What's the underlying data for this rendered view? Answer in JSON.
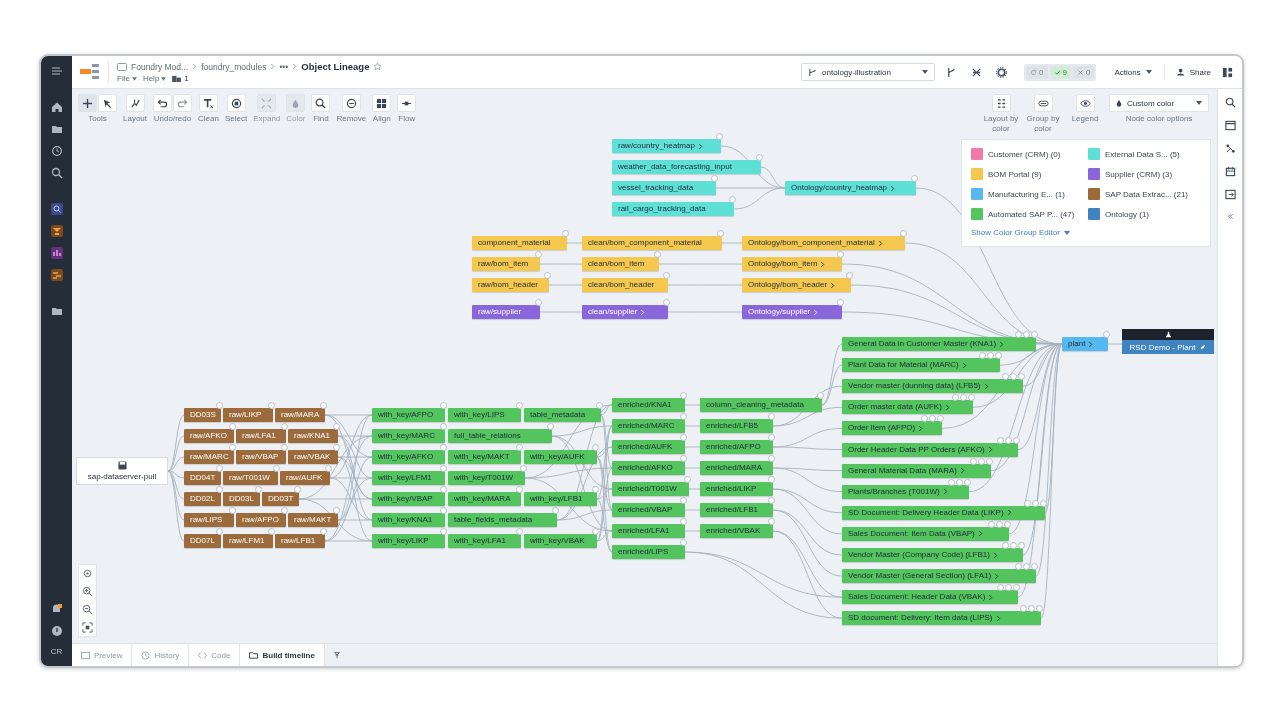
{
  "header": {
    "breadcrumbs": [
      "Foundry Mod...",
      "foundry_modules",
      "•••",
      "Object Lineage"
    ],
    "menus": [
      "File",
      "Help"
    ],
    "count": "1",
    "branch": "ontology-illustration",
    "checks": [
      {
        "kind": "running",
        "count": "0"
      },
      {
        "kind": "passed",
        "count": "9"
      },
      {
        "kind": "failed",
        "count": "0"
      }
    ],
    "actions": "Actions",
    "share": "Share"
  },
  "sidebar": {
    "avatar": "CR"
  },
  "toolbar": [
    {
      "kind": "tools",
      "label": "Tools",
      "disabled": false
    },
    {
      "kind": "layout",
      "label": "Layout",
      "disabled": false
    },
    {
      "kind": "undo",
      "label": "Undo/redo",
      "disabled": false
    },
    {
      "kind": "clean",
      "label": "Clean",
      "disabled": false
    },
    {
      "kind": "select",
      "label": "Select",
      "disabled": false
    },
    {
      "kind": "expand",
      "label": "Expand",
      "disabled": true
    },
    {
      "kind": "color",
      "label": "Color",
      "disabled": true
    },
    {
      "kind": "find",
      "label": "Find",
      "disabled": false
    },
    {
      "kind": "remove",
      "label": "Remove",
      "disabled": false
    },
    {
      "kind": "align",
      "label": "Align",
      "disabled": false
    },
    {
      "kind": "flow",
      "label": "Flow",
      "disabled": false
    }
  ],
  "view_controls": [
    {
      "kind": "layout",
      "label": "Layout by color"
    },
    {
      "kind": "group",
      "label": "Group by color"
    },
    {
      "kind": "legend",
      "label": "Legend"
    }
  ],
  "color_select": {
    "value": "Custom color",
    "caption": "Node color options"
  },
  "legend": {
    "items": [
      {
        "label": "Customer (CRM) (0)",
        "color": "#ee7ba9"
      },
      {
        "label": "External Data S... (5)",
        "color": "#5fe0d6"
      },
      {
        "label": "BOM Portal (9)",
        "color": "#f4c84f"
      },
      {
        "label": "Supplier (CRM) (3)",
        "color": "#8a66db"
      },
      {
        "label": "Manufacturing E... (1)",
        "color": "#57b8ef"
      },
      {
        "label": "SAP Data Extrac... (21)",
        "color": "#9b6b3c"
      },
      {
        "label": "Automated SAP P... (47)",
        "color": "#54c45e"
      },
      {
        "label": "Ontology (1)",
        "color": "#3f84c1"
      }
    ],
    "link": "Show Color Group Editor"
  },
  "graph": {
    "external": {
      "color": "#5fe0d6",
      "sources": [
        {
          "label": "raw/country_heatmap",
          "chevron": true
        },
        {
          "label": "weather_data_forecasting_input",
          "chevron": false
        },
        {
          "label": "vessel_tracking_data",
          "chevron": false
        },
        {
          "label": "rail_cargo_tracking_data",
          "chevron": false
        }
      ],
      "target": {
        "label": "Ontology/country_heatmap",
        "chevron": true
      }
    },
    "bom_rows": [
      {
        "color": "#f4c84f",
        "nodes": [
          {
            "label": "component_material",
            "chevron": false
          },
          {
            "label": "clean/bom_component_material",
            "chevron": false
          },
          {
            "label": "Ontology/bom_component_material",
            "chevron": true
          }
        ]
      },
      {
        "color": "#f4c84f",
        "nodes": [
          {
            "label": "raw/bom_item",
            "chevron": false
          },
          {
            "label": "clean/bom_item",
            "chevron": false
          },
          {
            "label": "Ontology/bom_item",
            "chevron": true
          }
        ]
      },
      {
        "color": "#f4c84f",
        "nodes": [
          {
            "label": "raw/bom_header",
            "chevron": false
          },
          {
            "label": "clean/bom_header",
            "chevron": false
          },
          {
            "label": "Ontology/bom_header",
            "chevron": true
          }
        ]
      },
      {
        "color": "#8a66db",
        "nodes": [
          {
            "label": "raw/supplier",
            "chevron": false
          },
          {
            "label": "clean/supplier",
            "chevron": true
          },
          {
            "label": "Ontology/supplier",
            "chevron": true
          }
        ]
      }
    ],
    "source": {
      "label": "sap-dataserver-pull"
    },
    "raw_rows": {
      "color": "#9b6b3c",
      "rows": [
        [
          "DD03S",
          "raw/LIKP",
          "raw/MARA"
        ],
        [
          "raw/AFKO",
          "raw/LFA1",
          "raw/KNA1"
        ],
        [
          "raw/MARC",
          "raw/VBAP",
          "raw/VBAK"
        ],
        [
          "DD04T",
          "raw/T001W",
          "raw/AUFK"
        ],
        [
          "DD02L",
          "DD03L",
          "DD03T"
        ],
        [
          "raw/LIPS",
          "raw/AFPO",
          "raw/MAKT"
        ],
        [
          "DD07L",
          "raw/LFM1",
          "raw/LFB1"
        ]
      ]
    },
    "key_rows": {
      "color": "#54c45e",
      "rows": [
        [
          "with_key/AFPO",
          "with_key/LIPS",
          "table_metadata"
        ],
        [
          "with_key/MARC",
          "full_table_relations"
        ],
        [
          "with_key/AFKO",
          "with_key/MAKT",
          "with_key/AUFK"
        ],
        [
          "with_key/LFM1",
          "with_key/T001W"
        ],
        [
          "with_key/VBAP",
          "with_key/MARA",
          "with_key/LFB1"
        ],
        [
          "with_key/KNA1",
          "table_fields_metadata"
        ],
        [
          "with_key/LIKP",
          "with_key/LFA1",
          "with_key/VBAK"
        ]
      ]
    },
    "enriched": {
      "color": "#54c45e",
      "columns": [
        [
          "enriched/KNA1",
          "enriched/MARC",
          "enriched/AUFK",
          "enriched/AFKO",
          "enriched/T001W",
          "enriched/VBAP",
          "enriched/LFA1",
          "enriched/LIPS"
        ],
        [
          "column_cleaning_metadata",
          "enriched/LFB5",
          "enriched/AFPO",
          "enriched/MARA",
          "enriched/LIKP",
          "enriched/LFB1",
          "enriched/VBAK"
        ]
      ]
    },
    "outputs": {
      "color": "#54c45e",
      "nodes": [
        {
          "label": "General Data in Customer Master (KNA1)",
          "chevron": true
        },
        {
          "label": "Plant Data for Material (MARC)",
          "chevron": true
        },
        {
          "label": "Vendor master (dunning data) (LFB5)",
          "chevron": true
        },
        {
          "label": "Order master data (AUFK)",
          "chevron": true
        },
        {
          "label": "Order item (AFPO)",
          "chevron": true
        },
        {
          "label": "Order Header Data PP Orders (AFKO)",
          "chevron": true
        },
        {
          "label": "General Material Data (MARA)",
          "chevron": true
        },
        {
          "label": "Plants/Branches (T001W)",
          "chevron": true
        },
        {
          "label": "SD Document: Delivery Header Data (LIKP)",
          "chevron": true
        },
        {
          "label": "Sales Document: Item Data (VBAP)",
          "chevron": true
        },
        {
          "label": "Vendor Master (Company Code) (LFB1)",
          "chevron": true
        },
        {
          "label": "Vendor Master (General Section) (LFA1)",
          "chevron": true
        },
        {
          "label": "Sales Document: Header Data (VBAK)",
          "chevron": true
        },
        {
          "label": "SD document: Delivery: Item data (LIPS)",
          "chevron": true
        }
      ]
    },
    "hub": {
      "label": "plant",
      "color": "#57b8ef",
      "chevron": true
    },
    "final": {
      "label": "RSD Demo - Plant",
      "color": "#3f84c1"
    }
  },
  "bottom_tabs": [
    {
      "kind": "preview",
      "label": "Preview",
      "selected": false
    },
    {
      "kind": "history",
      "label": "History",
      "selected": false
    },
    {
      "kind": "code",
      "label": "Code",
      "selected": false
    },
    {
      "kind": "timeline",
      "label": "Build timeline",
      "selected": true
    }
  ]
}
